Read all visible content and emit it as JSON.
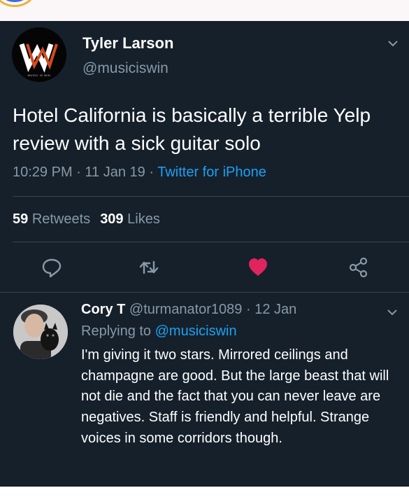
{
  "tweet": {
    "display_name": "Tyler Larson",
    "handle": "@musiciswin",
    "avatar_text": "MUSIC IS WIN",
    "text": "Hotel California is basically a terrible Yelp review with a sick guitar solo",
    "time": "10:29 PM",
    "date": "11 Jan 19",
    "source": "Twitter for iPhone",
    "separator": "·",
    "retweets_count": "59",
    "retweets_label": "Retweets",
    "likes_count": "309",
    "likes_label": "Likes"
  },
  "actions": [
    {
      "icon": "reply-icon"
    },
    {
      "icon": "retweet-icon"
    },
    {
      "icon": "like-icon-filled",
      "color": "#e0245e"
    },
    {
      "icon": "share-icon"
    }
  ],
  "reply": {
    "display_name": "Cory T",
    "handle": "@turmanator1089",
    "date": "12 Jan",
    "separator": "·",
    "replying_prefix": "Replying to",
    "replying_handle": "@musiciswin",
    "text": "I'm giving it two stars. Mirrored ceilings and champagne are good. But the large beast that will not die and the fact that you can never leave are negatives. Staff is friendly and helpful. Strange voices in some corridors though."
  },
  "colors": {
    "background": "#15202b",
    "secondary_text": "#8899a6",
    "link": "#1da1f2",
    "like": "#e0245e",
    "divider": "#38444d"
  }
}
